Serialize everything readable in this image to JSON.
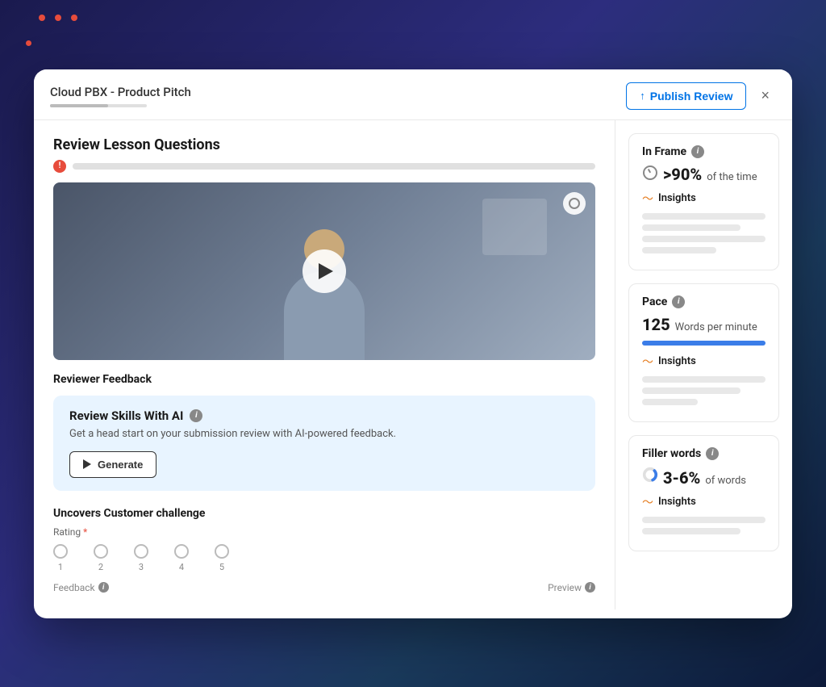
{
  "header": {
    "title": "Cloud PBX - Product Pitch",
    "publish_label": "Publish Review",
    "close_label": "×"
  },
  "left": {
    "section_title": "Review Lesson Questions",
    "reviewer_feedback_label": "Reviewer Feedback",
    "ai_review": {
      "title": "Review Skills With AI",
      "description": "Get a head start on your submission review with AI-powered feedback.",
      "generate_label": "Generate"
    },
    "question": {
      "label": "Uncovers Customer challenge",
      "rating_label": "Rating",
      "ratings": [
        "1",
        "2",
        "3",
        "4",
        "5"
      ],
      "feedback_label": "Feedback",
      "preview_label": "Preview"
    }
  },
  "right": {
    "inframe": {
      "title": "In Frame",
      "value": ">90%",
      "unit": "of the time",
      "insights_label": "Insights"
    },
    "pace": {
      "title": "Pace",
      "value": "125",
      "unit": "Words per minute",
      "insights_label": "Insights"
    },
    "filler": {
      "title": "Filler words",
      "value": "3-6%",
      "unit": "of words",
      "insights_label": "Insights"
    }
  },
  "icons": {
    "info": "i",
    "chart": "📈",
    "upload": "↑"
  }
}
